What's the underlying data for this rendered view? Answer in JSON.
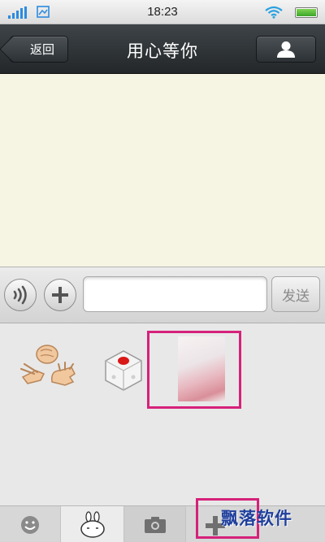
{
  "status_bar": {
    "time": "18:23",
    "icons": [
      "signal-icon",
      "sim-icon",
      "wifi-icon",
      "battery-icon"
    ]
  },
  "nav": {
    "back_label": "返回",
    "title": "用心等你",
    "profile_icon": "person-icon"
  },
  "input_bar": {
    "voice_icon": "voice-icon",
    "plus_icon": "plus-icon",
    "input_value": "",
    "send_label": "发送"
  },
  "panel": {
    "items": [
      "rock-paper-scissors",
      "dice",
      "photo"
    ]
  },
  "tabs": [
    "emoji-icon",
    "rabbit-icon",
    "camera-icon",
    "plus-icon"
  ],
  "watermark": "飘落软件",
  "colors": {
    "nav_bg": "#2e3336",
    "chat_bg": "#f6f5e4",
    "highlight": "#d6217a",
    "watermark": "#1f3f9c"
  }
}
